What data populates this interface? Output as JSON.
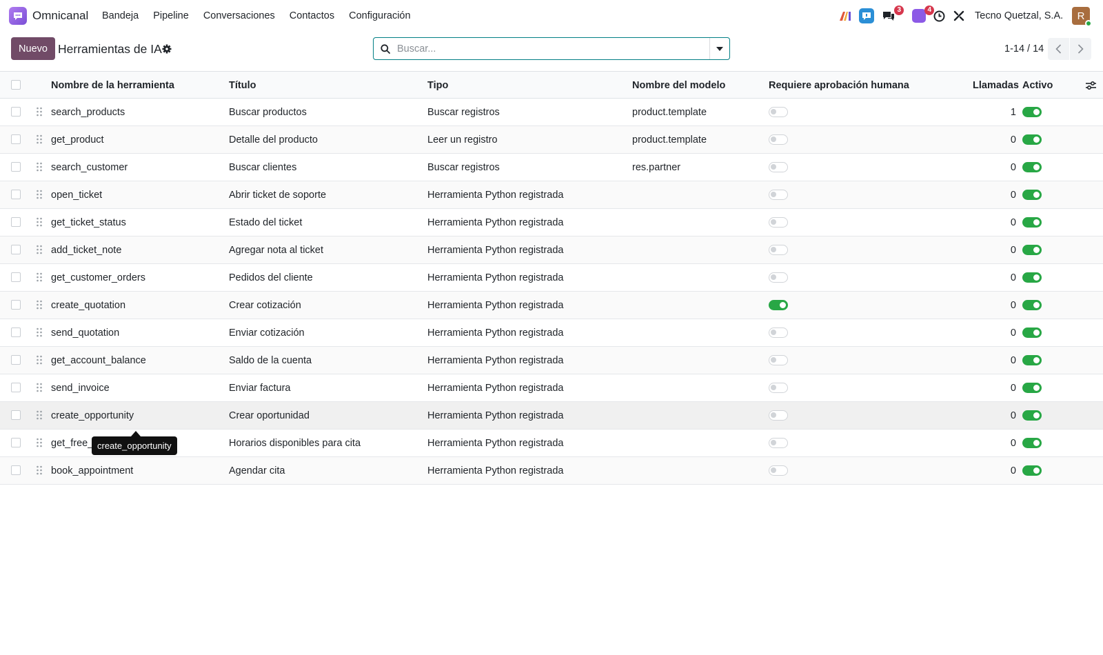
{
  "app": {
    "name": "Omnicanal"
  },
  "nav": [
    "Bandeja",
    "Pipeline",
    "Conversaciones",
    "Contactos",
    "Configuración"
  ],
  "systray": {
    "messages_badge": "3",
    "activities_badge": "4",
    "company": "Tecno Quetzal, S.A.",
    "avatar_letter": "R"
  },
  "control": {
    "new_label": "Nuevo",
    "title": "Herramientas de IA",
    "search_placeholder": "Buscar...",
    "pager": "1-14 / 14"
  },
  "columns": {
    "name": "Nombre de la herramienta",
    "title": "Título",
    "type": "Tipo",
    "model": "Nombre del modelo",
    "approval": "Requiere aprobación humana",
    "calls": "Llamadas",
    "active": "Activo"
  },
  "rows": [
    {
      "name": "search_products",
      "title": "Buscar productos",
      "type": "Buscar registros",
      "model": "product.template",
      "approval": false,
      "calls": "1",
      "active": true
    },
    {
      "name": "get_product",
      "title": "Detalle del producto",
      "type": "Leer un registro",
      "model": "product.template",
      "approval": false,
      "calls": "0",
      "active": true
    },
    {
      "name": "search_customer",
      "title": "Buscar clientes",
      "type": "Buscar registros",
      "model": "res.partner",
      "approval": false,
      "calls": "0",
      "active": true
    },
    {
      "name": "open_ticket",
      "title": "Abrir ticket de soporte",
      "type": "Herramienta Python registrada",
      "model": "",
      "approval": false,
      "calls": "0",
      "active": true
    },
    {
      "name": "get_ticket_status",
      "title": "Estado del ticket",
      "type": "Herramienta Python registrada",
      "model": "",
      "approval": false,
      "calls": "0",
      "active": true
    },
    {
      "name": "add_ticket_note",
      "title": "Agregar nota al ticket",
      "type": "Herramienta Python registrada",
      "model": "",
      "approval": false,
      "calls": "0",
      "active": true
    },
    {
      "name": "get_customer_orders",
      "title": "Pedidos del cliente",
      "type": "Herramienta Python registrada",
      "model": "",
      "approval": false,
      "calls": "0",
      "active": true
    },
    {
      "name": "create_quotation",
      "title": "Crear cotización",
      "type": "Herramienta Python registrada",
      "model": "",
      "approval": true,
      "calls": "0",
      "active": true
    },
    {
      "name": "send_quotation",
      "title": "Enviar cotización",
      "type": "Herramienta Python registrada",
      "model": "",
      "approval": false,
      "calls": "0",
      "active": true
    },
    {
      "name": "get_account_balance",
      "title": "Saldo de la cuenta",
      "type": "Herramienta Python registrada",
      "model": "",
      "approval": false,
      "calls": "0",
      "active": true
    },
    {
      "name": "send_invoice",
      "title": "Enviar factura",
      "type": "Herramienta Python registrada",
      "model": "",
      "approval": false,
      "calls": "0",
      "active": true
    },
    {
      "name": "create_opportunity",
      "title": "Crear oportunidad",
      "type": "Herramienta Python registrada",
      "model": "",
      "approval": false,
      "calls": "0",
      "active": true
    },
    {
      "name": "get_free_",
      "title": "Horarios disponibles para cita",
      "type": "Herramienta Python registrada",
      "model": "",
      "approval": false,
      "calls": "0",
      "active": true
    },
    {
      "name": "book_appointment",
      "title": "Agendar cita",
      "type": "Herramienta Python registrada",
      "model": "",
      "approval": false,
      "calls": "0",
      "active": true
    }
  ],
  "tooltip": "create_opportunity",
  "colors": {
    "brand": "#714b67",
    "toggle_on": "#28a745",
    "badge": "#d6374d",
    "search_border": "#017e84"
  }
}
